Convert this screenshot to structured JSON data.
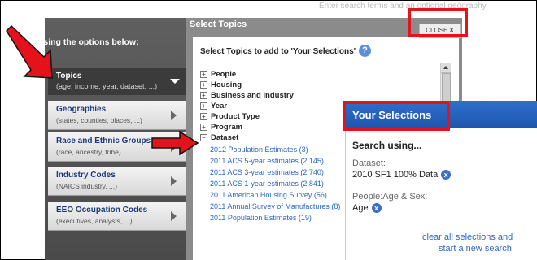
{
  "top_faint_text": "Enter search terms and an optional geography",
  "left": {
    "header": "Search using the options below:",
    "topics": {
      "label": "Topics",
      "sub": "(age, income, year, dataset, ...)"
    },
    "categories": [
      {
        "label": "Geographies",
        "sub": "(states, counties, places, ...)"
      },
      {
        "label": "Race and Ethnic Groups",
        "sub": "(race, ancestry, tribe)"
      },
      {
        "label": "Industry Codes",
        "sub": "(NAICS industry, ...)"
      },
      {
        "label": "EEO Occupation Codes",
        "sub": "(executives, analysts, ...)"
      }
    ]
  },
  "select_topics": {
    "title": "Select Topics",
    "close_label": "CLOSE",
    "close_x": "X",
    "heading": "Select Topics to add to 'Your Selections'",
    "help": "?",
    "tree": [
      {
        "toggle": "+",
        "label": "People"
      },
      {
        "toggle": "+",
        "label": "Housing"
      },
      {
        "toggle": "+",
        "label": "Business and Industry"
      },
      {
        "toggle": "+",
        "label": "Year"
      },
      {
        "toggle": "+",
        "label": "Product Type"
      },
      {
        "toggle": "+",
        "label": "Program"
      },
      {
        "toggle": "−",
        "label": "Dataset"
      }
    ],
    "datasets": [
      "2012 Population Estimates (3)",
      "2011 ACS 5-year estimates (2,145)",
      "2011 ACS 3-year estimates (2,740)",
      "2011 ACS 1-year estimates (2,841)",
      "2011 American Housing Survey (56)",
      "2011 Annual Survey of Manufactures (8)",
      "2011 Population Estimates (19)"
    ]
  },
  "your_selections": {
    "title": "Your Selections",
    "search_using": "Search using...",
    "dataset_label": "Dataset:",
    "dataset_value": "2010 SF1 100% Data",
    "people_label": "People:Age & Sex:",
    "people_value": "Age",
    "remove_glyph": "x",
    "clear_line1": "clear all selections and",
    "clear_line2": "start a new search"
  },
  "colors": {
    "highlight_red": "#e3121b",
    "accent_blue": "#2f6fcc",
    "link_blue": "#2b67c7"
  }
}
